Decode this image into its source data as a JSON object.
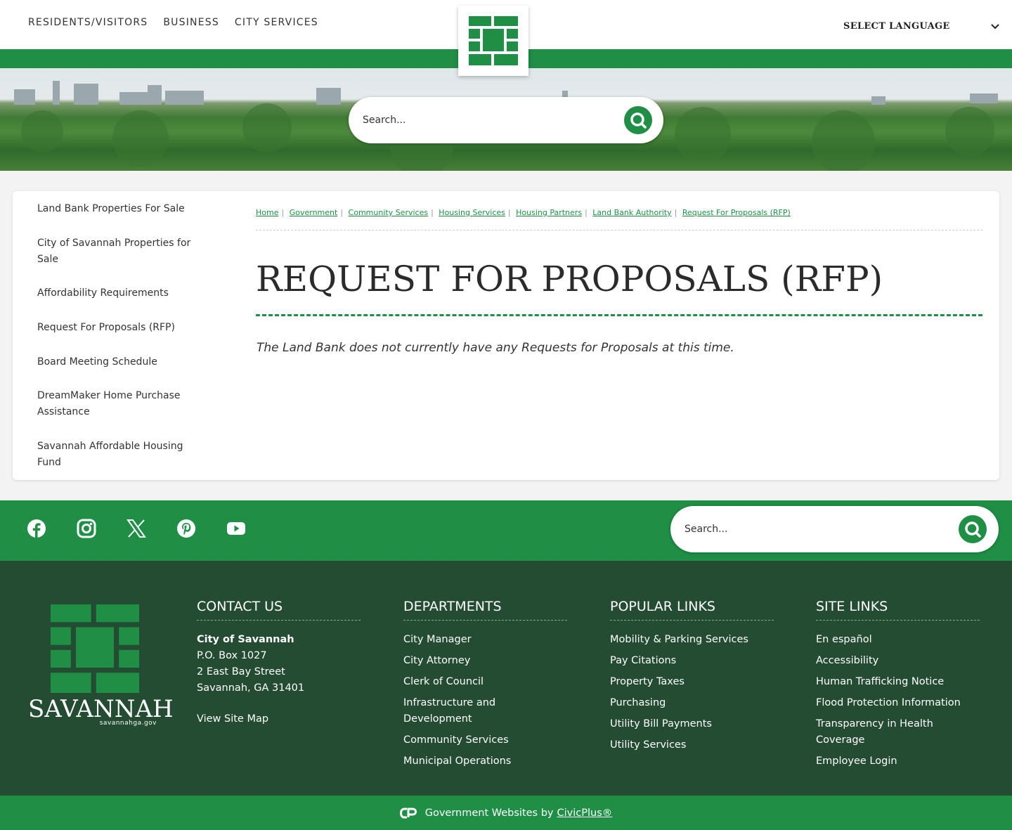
{
  "colors": {
    "brand_green": "#1e8f45",
    "footer_green": "#234c33",
    "white": "#ffffff"
  },
  "header": {
    "nav": [
      "RESIDENTS/VISITORS",
      "BUSINESS",
      "CITY SERVICES"
    ],
    "language_label": "SELECT LANGUAGE",
    "logo_icon": "savannah-brick-logo-icon"
  },
  "hero": {
    "search_placeholder": "Search..."
  },
  "sidebar": {
    "items": [
      {
        "label": "Land Bank Properties For Sale"
      },
      {
        "label": "City of Savannah Properties for Sale"
      },
      {
        "label": "Affordability Requirements"
      },
      {
        "label": "Request For Proposals (RFP)"
      },
      {
        "label": "Board Meeting Schedule"
      },
      {
        "label": "DreamMaker Home Purchase Assistance"
      },
      {
        "label": "Savannah Affordable Housing Fund"
      }
    ]
  },
  "breadcrumb": [
    "Home",
    "Government",
    "Community Services",
    "Housing Services",
    "Housing Partners",
    "Land Bank Authority",
    "Request For Proposals (RFP)"
  ],
  "main": {
    "title": "REQUEST FOR PROPOSALS (RFP)",
    "notice": "The Land Bank does not currently have any Requests for Proposals at this time."
  },
  "social": {
    "icons": [
      "facebook-icon",
      "instagram-icon",
      "x-twitter-icon",
      "pinterest-icon",
      "youtube-icon"
    ],
    "search_placeholder": "Search..."
  },
  "footer": {
    "logo": {
      "wordmark": "SAVANNAH",
      "url": "savannahga.gov"
    },
    "contact": {
      "heading": "CONTACT US",
      "name": "City of Savannah",
      "lines": [
        "P.O. Box 1027",
        "2 East Bay Street",
        "Savannah, GA 31401"
      ],
      "site_map": "View Site Map"
    },
    "departments": {
      "heading": "DEPARTMENTS",
      "links": [
        "City Manager",
        "City Attorney",
        "Clerk of Council",
        "Infrastructure and Development",
        "Community Services",
        "Municipal Operations"
      ]
    },
    "popular": {
      "heading": "POPULAR LINKS",
      "links": [
        "Mobility & Parking Services",
        "Pay Citations",
        "Property Taxes",
        "Purchasing",
        "Utility Bill Payments",
        "Utility Services"
      ]
    },
    "site": {
      "heading": "SITE LINKS",
      "links": [
        "En español",
        "Accessibility",
        "Human Trafficking Notice",
        "Flood Protection Information",
        "Transparency in Health Coverage",
        "Employee Login"
      ]
    },
    "credit_prefix": "Government Websites by",
    "credit_link": "CivicPlus®"
  }
}
